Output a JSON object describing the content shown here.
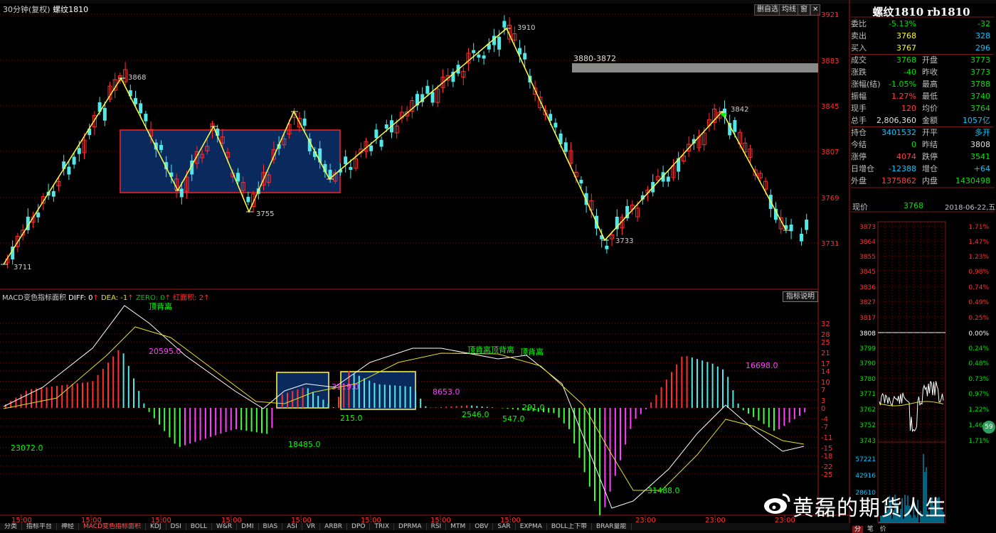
{
  "header": {
    "period": "30分钟(复权)",
    "symbol": "螺纹1810",
    "buttons": [
      "删自选",
      "均线",
      "窗"
    ]
  },
  "price_axis": [
    "3921",
    "3883",
    "3845",
    "3807",
    "3769",
    "3731"
  ],
  "annotations": {
    "high_1": "3868",
    "low_start": "3711",
    "low_mid": "3755",
    "high_top": "3910",
    "gap_label": "3880-3872",
    "low_right": "3733",
    "high_right": "3842"
  },
  "macd": {
    "title": "MACD变色指标面积",
    "diff_label": "DIFF: 0",
    "dea_label": "DEA: -1",
    "zero_label": "ZERO: 0",
    "red_label": "红面积: 2",
    "explain_button": "指标说明",
    "axis": [
      "32",
      "28",
      "25",
      "21",
      "17",
      "14",
      "10",
      "7",
      "3",
      "0",
      "-4",
      "-7",
      "-11",
      "-15",
      "-18",
      "-22",
      "-25"
    ],
    "labels": {
      "divergence_1": "顶背离",
      "divergence_2": "顶背离顶背离",
      "divergence_3": "顶背离",
      "area_1": "20595.0",
      "area_2": "23072.0",
      "area_3": "18485.0",
      "area_4": "215.0",
      "area_5": "3119.0",
      "area_6": "8653.0",
      "area_7": "2546.0",
      "area_8": "547.0",
      "area_9": "291.0",
      "area_10": "16698.0",
      "area_11": "31488.0"
    }
  },
  "time_axis": [
    "15:00",
    "15:00",
    "15:00",
    "15:00",
    "15:00",
    "15:00",
    "15:00",
    "15:00",
    "23:00",
    "23:00",
    "23:00"
  ],
  "tabs": [
    "分类",
    "指标平台",
    "神经",
    "MACD变色指标面积",
    "KDJ",
    "DSI",
    "BOLL",
    "W&R",
    "DMI",
    "BIAS",
    "ASI",
    "VR",
    "ARBR",
    "DPO",
    "TRIX",
    "DPRMA",
    "RSI",
    "MTM",
    "OBV",
    "SAR",
    "EXPMA",
    "BOLL上下带",
    "BRAR量能"
  ],
  "quote": {
    "title": "螺纹1810 rb1810",
    "rows": [
      {
        "l1": "委比",
        "v1": "-5.13%",
        "c1": "#00e000",
        "l2": "",
        "v2": "-32",
        "c2": "#00e000"
      },
      {
        "l1": "卖出",
        "v1": "3768",
        "c1": "#ffff00",
        "l2": "",
        "v2": "328",
        "c2": "#00c8ff"
      },
      {
        "l1": "买入",
        "v1": "3767",
        "c1": "#ffff00",
        "l2": "",
        "v2": "296",
        "c2": "#00c8ff"
      },
      {
        "l1": "成交",
        "v1": "3768",
        "c1": "#00e000",
        "l2": "开盘",
        "v2": "3773",
        "c2": "#00e000"
      },
      {
        "l1": "涨跌",
        "v1": "-40",
        "c1": "#00e000",
        "l2": "昨收",
        "v2": "3773",
        "c2": "#00e000"
      },
      {
        "l1": "涨幅(结)",
        "v1": "-1.05%",
        "c1": "#00e000",
        "l2": "最高",
        "v2": "3788",
        "c2": "#00e000"
      },
      {
        "l1": "振幅",
        "v1": "1.27%",
        "c1": "#ff4040",
        "l2": "最低",
        "v2": "3740",
        "c2": "#00e000"
      },
      {
        "l1": "现手",
        "v1": "120",
        "c1": "#ff4040",
        "l2": "均价",
        "v2": "3764",
        "c2": "#00e000"
      },
      {
        "l1": "总手",
        "v1": "2,806,360",
        "c1": "#e0e0e0",
        "l2": "金额",
        "v2": "1057亿",
        "c2": "#00c8ff"
      },
      {
        "l1": "持仓",
        "v1": "3401532",
        "c1": "#00c8ff",
        "l2": "开平",
        "v2": "多开",
        "c2": "#00c8ff"
      },
      {
        "l1": "今结",
        "v1": "0",
        "c1": "#00e000",
        "l2": "昨结",
        "v2": "3808",
        "c2": "#e0e0e0"
      },
      {
        "l1": "涨停",
        "v1": "4074",
        "c1": "#ff4040",
        "l2": "跌停",
        "v2": "3541",
        "c2": "#00e000"
      },
      {
        "l1": "日增仓",
        "v1": "-12388",
        "c1": "#00c8ff",
        "l2": "增仓",
        "v2": "+64",
        "c2": "#00c8ff"
      },
      {
        "l1": "外盘",
        "v1": "1375862",
        "c1": "#ff4040",
        "l2": "内盘",
        "v2": "1430498",
        "c2": "#00e000"
      }
    ],
    "current_label": "现价",
    "current_value": "3768",
    "date": "2018-06-22,五"
  },
  "mini_chart": {
    "left_axis": [
      "3873",
      "3864",
      "3855",
      "3845",
      "3836",
      "3827",
      "3817",
      "3808",
      "3799",
      "3790",
      "3780",
      "3771",
      "3762",
      "3752",
      "3743"
    ],
    "right_axis": [
      "1.71%",
      "1.47%",
      "1.23%",
      "0.98%",
      "0.74%",
      "0.49%",
      "0.25%",
      "0.00%",
      "0.24%",
      "0.48%",
      "0.73%",
      "0.97%",
      "1.22%",
      "1.46%",
      "1.71%"
    ],
    "vol_axis": [
      "57221",
      "42916",
      "28610"
    ],
    "badge": "59"
  },
  "bottom_tabs": [
    "分",
    "笔",
    "价"
  ],
  "watermark": "黄磊的期货人生",
  "colors": {
    "up": "#ff3030",
    "down": "#50e8e8",
    "zigzag": "#ffff40",
    "box_fill": "#0a2a5e",
    "box_border": "#ff2020",
    "grid": "#701010",
    "gap_band": "#8a8a8a",
    "magenta": "#ff40ff",
    "green": "#00ff00"
  }
}
